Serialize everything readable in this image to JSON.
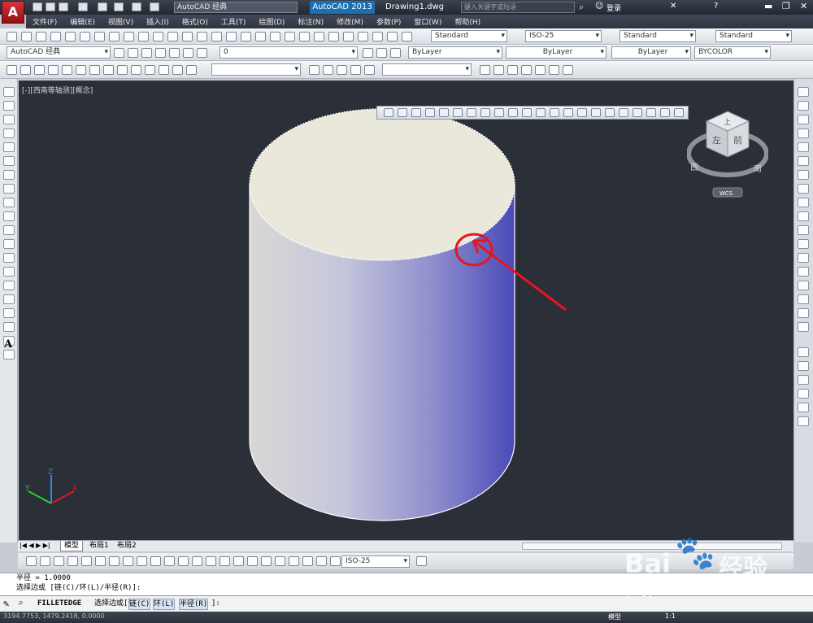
{
  "app": {
    "logo_letter": "A",
    "title": "AutoCAD 2013",
    "document": "Drawing1.dwg",
    "workspace": "AutoCAD 经典",
    "search_placeholder": "键入关键字或短语",
    "login": "登录"
  },
  "menu": [
    "文件(F)",
    "编辑(E)",
    "视图(V)",
    "插入(I)",
    "格式(O)",
    "工具(T)",
    "绘图(D)",
    "标注(N)",
    "修改(M)",
    "参数(P)",
    "窗口(W)",
    "帮助(H)"
  ],
  "styles": {
    "text_style": "Standard",
    "dim_style": "ISO-25",
    "table_style": "Standard",
    "mleader_style": "Standard"
  },
  "layers": {
    "workspace": "AutoCAD 经典",
    "current_layer": "0",
    "color": "ByLayer",
    "linetype": "ByLayer",
    "lineweight": "ByLayer",
    "plotstyle": "BYCOLOR"
  },
  "viewport": {
    "label": "[-][西南等轴测][概念]"
  },
  "viewcube": {
    "top": "上",
    "left": "左",
    "front": "前",
    "west": "西",
    "south": "南",
    "wcs": "WCS"
  },
  "ucs": {
    "x": "X",
    "y": "Y",
    "z": "Z"
  },
  "layout_tabs": [
    "模型",
    "布局1",
    "布局2"
  ],
  "dim_toolbar": {
    "dim_style": "ISO-25"
  },
  "command_history": [
    "半径 = 1.0000",
    "选择边或 [链(C)/环(L)/半径(R)]:"
  ],
  "command_line": {
    "command": "FILLETEDGE",
    "prompt": "选择边或",
    "option1": "链(C)",
    "option2": "环(L)",
    "option3": "半径(R)",
    "suffix": "]:"
  },
  "status": {
    "coords": "3194.7753, 1479.2418, 0.0000",
    "model": "模型",
    "scale": "1:1"
  },
  "watermark": {
    "brand": "Bai",
    "brand2": "经验",
    "url": "jingyan.baidu.com"
  },
  "colors": {
    "viewport_bg": "#2a2f38",
    "cylinder_top": "#e9e8da",
    "annotation": "#e8141e"
  }
}
